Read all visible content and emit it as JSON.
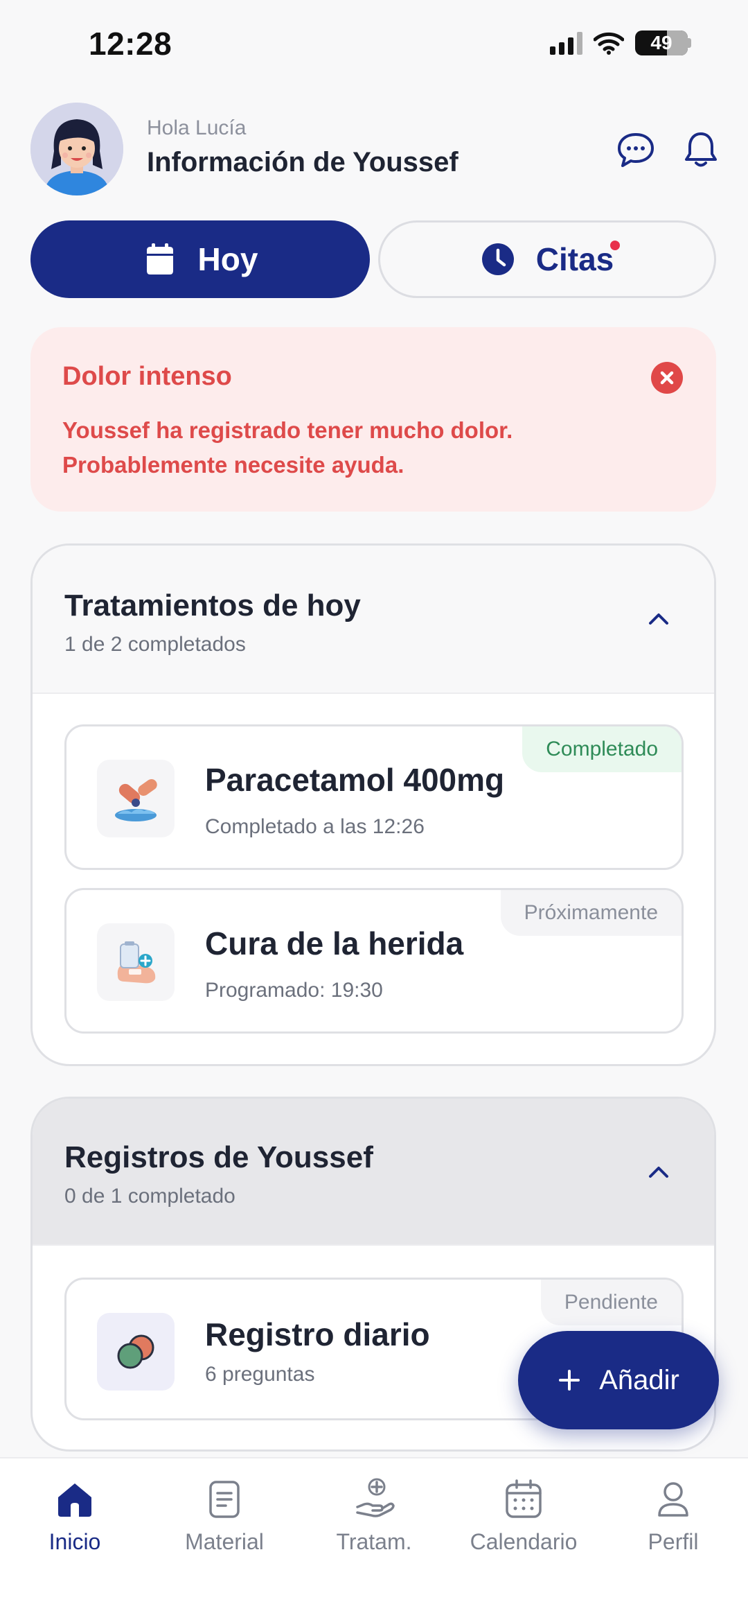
{
  "status_bar": {
    "time": "12:28",
    "battery": "49"
  },
  "header": {
    "greeting": "Hola Lucía",
    "title": "Información de Youssef",
    "icons": [
      "chat-bubble-icon",
      "bell-icon"
    ]
  },
  "tabs": [
    {
      "label": "Hoy",
      "icon": "calendar-icon",
      "active": true
    },
    {
      "label": "Citas",
      "icon": "clock-icon",
      "active": false,
      "has_dot": true
    }
  ],
  "alert": {
    "title": "Dolor intenso",
    "message": "Youssef ha registrado tener mucho dolor. Probablemente necesite ayuda.",
    "color": "#de4a4a"
  },
  "treatments": {
    "title": "Tratamientos de hoy",
    "subtitle": "1 de 2 completados",
    "items": [
      {
        "name": "Paracetamol 400mg",
        "detail": "Completado a las 12:26",
        "status": "Completado",
        "icon": "pills-icon"
      },
      {
        "name": "Cura de la herida",
        "detail": "Programado: 19:30",
        "status": "Próximamente",
        "icon": "wound-care-icon"
      }
    ]
  },
  "records": {
    "title": "Registros de Youssef",
    "subtitle": "0 de 1 completado",
    "items": [
      {
        "name": "Registro diario",
        "detail": "6 preguntas",
        "status": "Pendiente",
        "icon": "record-icon"
      }
    ]
  },
  "fab": {
    "label": "Añadir",
    "icon": "plus-icon"
  },
  "bottom_nav": [
    {
      "label": "Inicio",
      "icon": "home-icon",
      "active": true
    },
    {
      "label": "Material",
      "icon": "document-icon",
      "active": false
    },
    {
      "label": "Tratam.",
      "icon": "hand-plus-icon",
      "active": false
    },
    {
      "label": "Calendario",
      "icon": "calendar-icon",
      "active": false
    },
    {
      "label": "Perfil",
      "icon": "user-icon",
      "active": false
    }
  ],
  "colors": {
    "primary": "#1a2b86",
    "alert": "#de4a4a",
    "success": "#2e8b57",
    "notification_dot": "#e8304b"
  }
}
